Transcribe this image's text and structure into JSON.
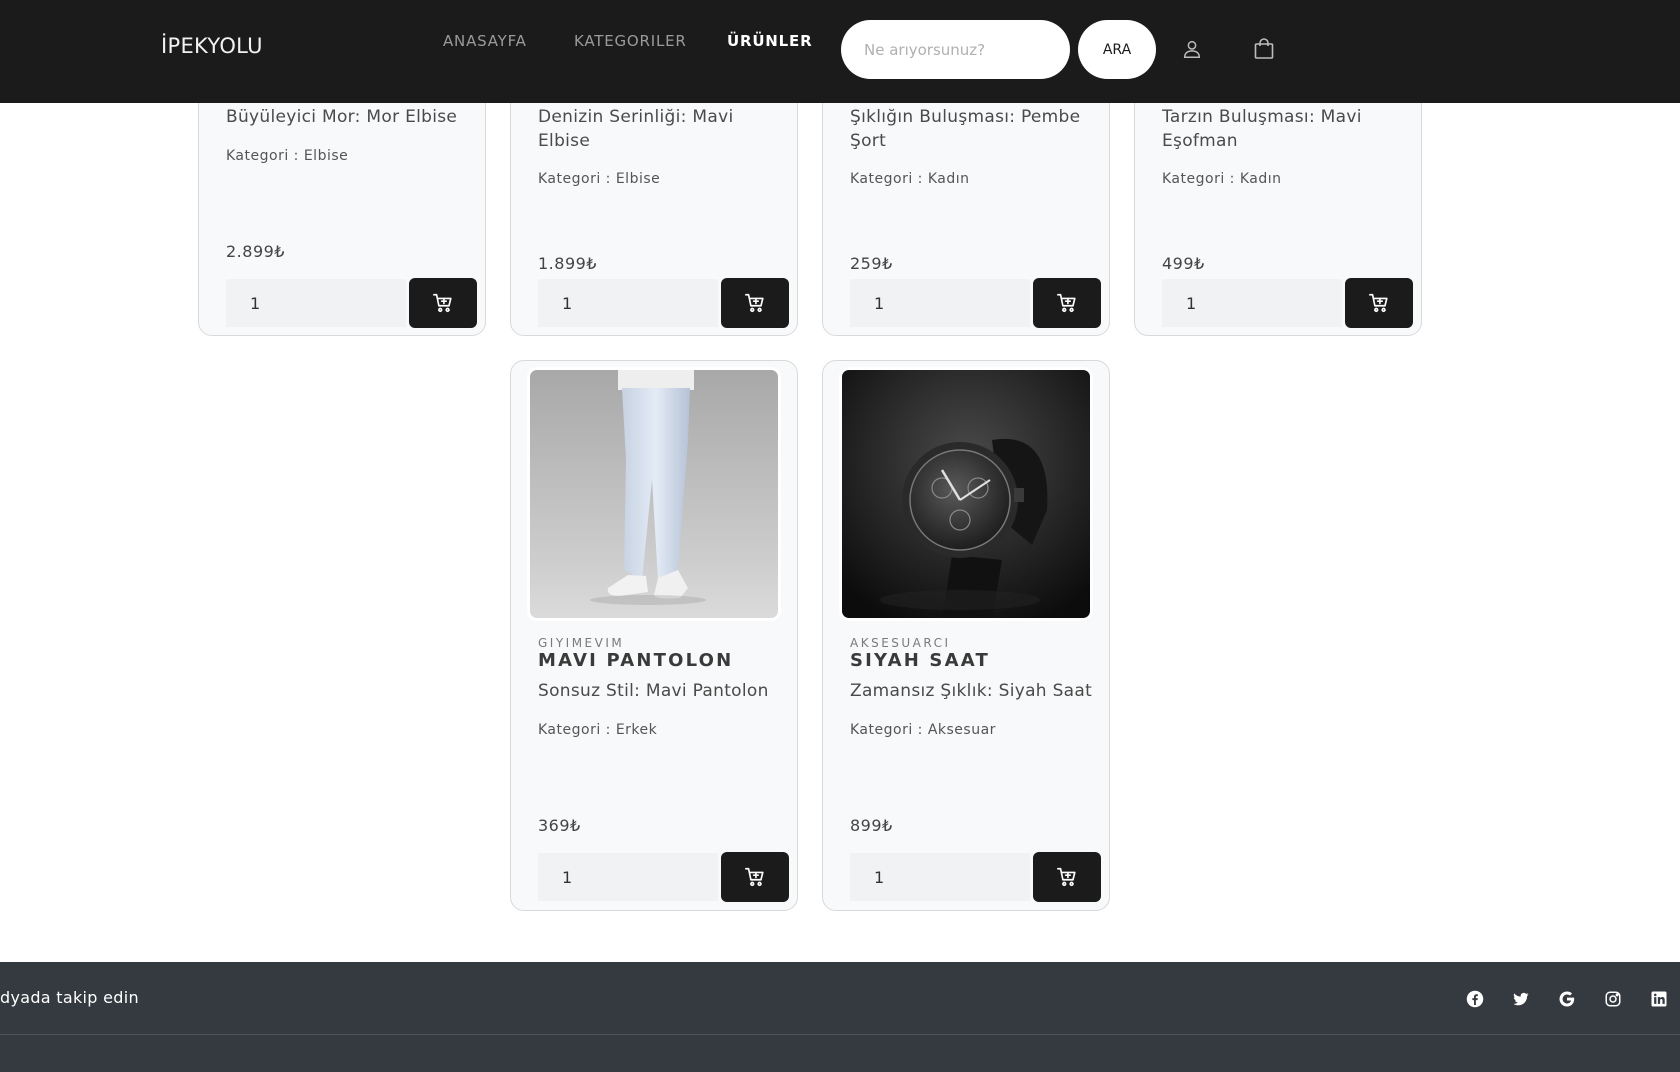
{
  "nav": {
    "brand": "İPEKYOLU",
    "links": [
      {
        "label": "ANASAYFA"
      },
      {
        "label": "KATEGORILER"
      },
      {
        "label": "ÜRÜNLER"
      }
    ],
    "search_placeholder": "Ne arıyorsunuz?",
    "search_button": "ARA",
    "icons": [
      "user-icon",
      "shopping-bag-icon"
    ]
  },
  "products_top": [
    {
      "desc": "Büyüleyici Mor: Mor Elbise",
      "category": "Kategori : Elbise",
      "price": "2.899₺",
      "qty": "1"
    },
    {
      "desc": "Denizin Serinliği: Mavi Elbise",
      "category": "Kategori : Elbise",
      "price": "1.899₺",
      "qty": "1"
    },
    {
      "desc": "Şıklığın Buluşması: Pembe Şort",
      "category": "Kategori : Kadın",
      "price": "259₺",
      "qty": "1"
    },
    {
      "desc": "Tarzın Buluşması: Mavi Eşofman",
      "category": "Kategori : Kadın",
      "price": "499₺",
      "qty": "1"
    }
  ],
  "products_bottom": [
    {
      "brand": "GIYIMEVIM",
      "title": "MAVI PANTOLON",
      "desc": "Sonsuz Stil: Mavi Pantolon",
      "category": "Kategori : Erkek",
      "price": "369₺",
      "qty": "1"
    },
    {
      "brand": "AKSESUARCI",
      "title": "SIYAH SAAT",
      "desc": "Zamansız Şıklık: Siyah Saat",
      "category": "Kategori : Aksesuar",
      "price": "899₺",
      "qty": "1"
    }
  ],
  "footer": {
    "text": "dyada takip edin",
    "social_icons": [
      "facebook-icon",
      "twitter-icon",
      "google-icon",
      "instagram-icon",
      "linkedin-icon"
    ]
  },
  "colors": {
    "navbar": "#1b1b1b",
    "footer": "#343a40",
    "card_bg": "#f8f9fa",
    "cart_button": "#1b1b1b"
  }
}
